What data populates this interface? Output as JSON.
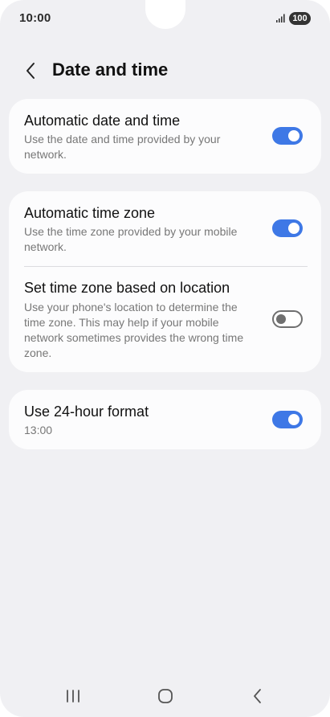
{
  "status_bar": {
    "time": "10:00",
    "battery": "100"
  },
  "header": {
    "title": "Date and time"
  },
  "settings": {
    "auto_date_time": {
      "title": "Automatic date and time",
      "description": "Use the date and time provided by your network.",
      "enabled": true
    },
    "auto_time_zone": {
      "title": "Automatic time zone",
      "description": "Use the time zone provided by your mobile network.",
      "enabled": true
    },
    "location_time_zone": {
      "title": "Set time zone based on location",
      "description": "Use your phone's location to determine the time zone. This may help if your mobile network sometimes provides the wrong time zone.",
      "enabled": false
    },
    "hour_24_format": {
      "title": "Use 24-hour format",
      "description": "13:00",
      "enabled": true
    }
  },
  "colors": {
    "accent": "#3e78e6",
    "background": "#f0f0f3",
    "card": "#fcfcfd"
  },
  "icons": {
    "back": "chevron-left-icon",
    "signal": "signal-icon",
    "nav_recents": "recents-icon",
    "nav_home": "home-icon",
    "nav_back": "back-icon"
  }
}
